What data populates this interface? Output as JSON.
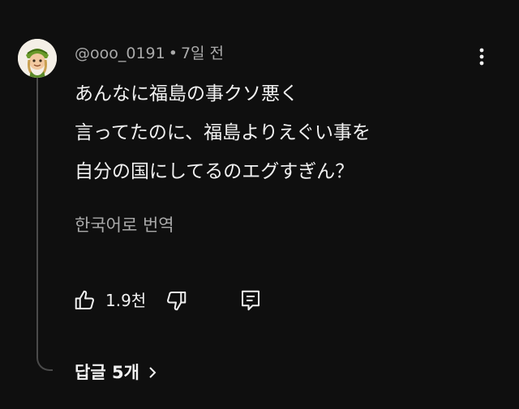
{
  "comment": {
    "author": "@ooo_0191",
    "separator": "•",
    "time": "7일 전",
    "lines": [
      "あんなに福島の事クソ悪く",
      "言ってたのに、福島よりえぐい事を",
      "自分の国にしてるのエグすぎん？"
    ],
    "translate_label": "한국어로 번역",
    "like_count": "1.9천",
    "replies_label": "답글 5개"
  },
  "icons": {
    "avatar": "avatar-character",
    "more": "more-vert-icon",
    "like": "thumbs-up-icon",
    "dislike": "thumbs-down-icon",
    "reply": "comment-reply-icon",
    "chevron": "chevron-right-icon"
  },
  "colors": {
    "background": "#0f0f0f",
    "text_primary": "#f1f1f1",
    "text_secondary": "#aaaaaa",
    "thread_line": "#4a4a4a"
  }
}
